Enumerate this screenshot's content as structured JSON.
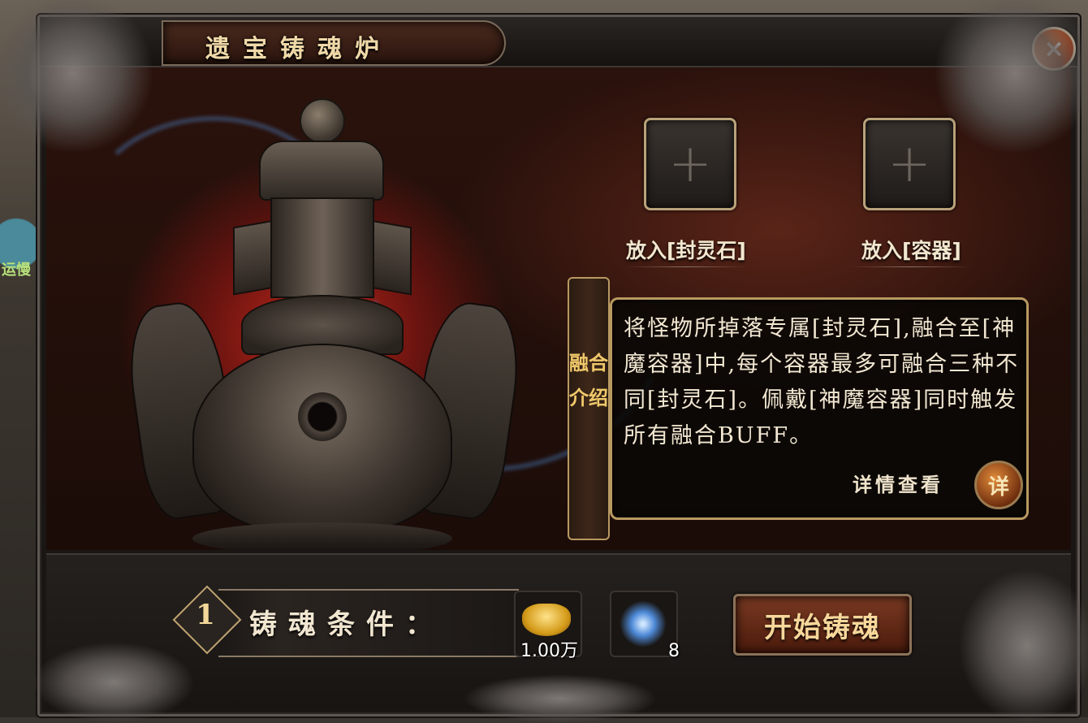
{
  "window": {
    "title": "遗宝铸魂炉",
    "close_label": "×"
  },
  "background": {
    "side_text": "运慢"
  },
  "slots": [
    {
      "label": "放入[封灵石]",
      "icon": "plus-icon"
    },
    {
      "label": "放入[容器]",
      "icon": "plus-icon"
    }
  ],
  "intro": {
    "tab_label": "融合介绍",
    "text": "将怪物所掉落专属[封灵石],融合至[神魔容器]中,每个容器最多可融合三种不同[封灵石]。佩戴[神魔容器]同时触发所有融合BUFF。",
    "detail_label": "详情查看",
    "detail_button": "详"
  },
  "conditions": {
    "step": "1",
    "label": "铸魂条件：",
    "items": [
      {
        "icon": "gold-ingot-icon",
        "count": "1.00万"
      },
      {
        "icon": "blue-crystal-icon",
        "count": "8"
      }
    ]
  },
  "actions": {
    "start_label": "开始铸魂"
  },
  "colors": {
    "accent_gold": "#b89960",
    "text_cream": "#f3e8d2",
    "glow_red": "#c0281a",
    "close_orange": "#e36a2a"
  }
}
